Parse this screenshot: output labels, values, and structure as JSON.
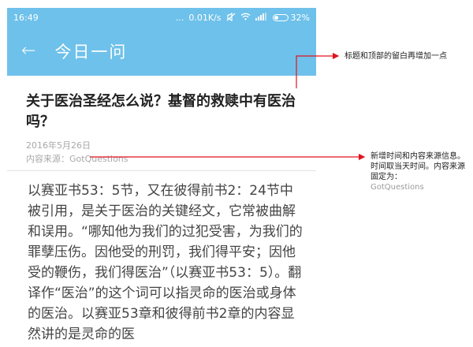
{
  "status_bar": {
    "time": "16:49",
    "dots": "...",
    "network_speed": "0.01K/s",
    "mute_icon": "mute-icon",
    "wifi_icon": "wifi-icon",
    "signal_icon": "signal-icon",
    "battery_percent": "32%",
    "battery_level": 0.32
  },
  "app_bar": {
    "back_icon": "←",
    "title": "今日一问"
  },
  "article": {
    "title": "关于医治圣经怎么说？基督的救赎中有医治吗？",
    "date": "2016年5月26日",
    "source": "内容来源：GotQuestions",
    "body": "以赛亚书53：5节，又在彼得前书2：24节中被引用，是关于医治的关键经文，它常被曲解和误用。“哪知他为我们的过犯受害，为我们的罪孽压伤。因他受的刑罚，我们得平安；因他受的鞭伤，我们得医治”（以赛亚书53：5）。翻译作“医治”的这个词可以指灵命的医治或身体的医治。以赛亚53章和彼得前书2章的内容显然讲的是灵命的医"
  },
  "annotations": {
    "top_note": "标题和顶部的留白再增加一点",
    "meta_note": "新增时间和内容来源信息。时间取当天时间。内容来源固定为：",
    "meta_note_source": "GotQuestions",
    "arrow_color": "#e0141e"
  },
  "colors": {
    "app_bar": "#6ec1ea",
    "title_text": "#222222",
    "meta_text": "#a8a8a8",
    "body_text": "#444444"
  }
}
